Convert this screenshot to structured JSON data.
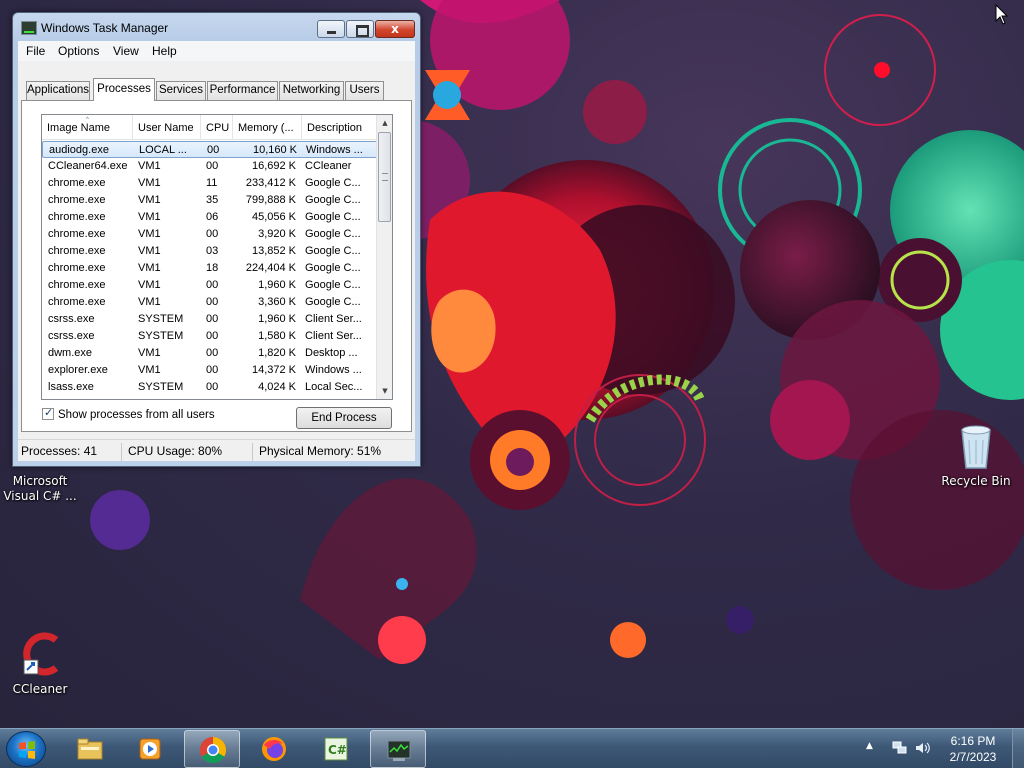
{
  "window": {
    "title": "Windows Task Manager",
    "close_glyph": "x"
  },
  "menu": [
    "File",
    "Options",
    "View",
    "Help"
  ],
  "tabs": [
    "Applications",
    "Processes",
    "Services",
    "Performance",
    "Networking",
    "Users"
  ],
  "active_tab": "Processes",
  "columns": [
    "Image Name",
    "User Name",
    "CPU",
    "Memory (...",
    "Description"
  ],
  "sort_indicator": "^",
  "processes": [
    {
      "name": "audiodg.exe",
      "user": "LOCAL ...",
      "cpu": "00",
      "memory": "10,160 K",
      "description": "Windows ..."
    },
    {
      "name": "CCleaner64.exe",
      "user": "VM1",
      "cpu": "00",
      "memory": "16,692 K",
      "description": "CCleaner"
    },
    {
      "name": "chrome.exe",
      "user": "VM1",
      "cpu": "11",
      "memory": "233,412 K",
      "description": "Google C..."
    },
    {
      "name": "chrome.exe",
      "user": "VM1",
      "cpu": "35",
      "memory": "799,888 K",
      "description": "Google C..."
    },
    {
      "name": "chrome.exe",
      "user": "VM1",
      "cpu": "06",
      "memory": "45,056 K",
      "description": "Google C..."
    },
    {
      "name": "chrome.exe",
      "user": "VM1",
      "cpu": "00",
      "memory": "3,920 K",
      "description": "Google C..."
    },
    {
      "name": "chrome.exe",
      "user": "VM1",
      "cpu": "03",
      "memory": "13,852 K",
      "description": "Google C..."
    },
    {
      "name": "chrome.exe",
      "user": "VM1",
      "cpu": "18",
      "memory": "224,404 K",
      "description": "Google C..."
    },
    {
      "name": "chrome.exe",
      "user": "VM1",
      "cpu": "00",
      "memory": "1,960 K",
      "description": "Google C..."
    },
    {
      "name": "chrome.exe",
      "user": "VM1",
      "cpu": "00",
      "memory": "3,360 K",
      "description": "Google C..."
    },
    {
      "name": "csrss.exe",
      "user": "SYSTEM",
      "cpu": "00",
      "memory": "1,960 K",
      "description": "Client Ser..."
    },
    {
      "name": "csrss.exe",
      "user": "SYSTEM",
      "cpu": "00",
      "memory": "1,580 K",
      "description": "Client Ser..."
    },
    {
      "name": "dwm.exe",
      "user": "VM1",
      "cpu": "00",
      "memory": "1,820 K",
      "description": "Desktop ..."
    },
    {
      "name": "explorer.exe",
      "user": "VM1",
      "cpu": "00",
      "memory": "14,372 K",
      "description": "Windows ..."
    },
    {
      "name": "lsass.exe",
      "user": "SYSTEM",
      "cpu": "00",
      "memory": "4,024 K",
      "description": "Local Sec..."
    }
  ],
  "selected_process_index": 0,
  "show_all_label": "Show processes from all users",
  "show_all_checked": true,
  "end_process_label": "End Process",
  "status": {
    "processes": "Processes: 41",
    "cpu": "CPU Usage: 80%",
    "memory": "Physical Memory: 51%"
  },
  "desktop_icons": {
    "visual_csharp": "Microsoft Visual C# ...",
    "ccleaner": "CCleaner",
    "recycle_bin": "Recycle Bin"
  },
  "taskbar": {
    "pinned": [
      "windows-explorer-icon",
      "media-player-icon",
      "chrome-icon",
      "firefox-icon",
      "visual-csharp-icon",
      "task-manager-icon"
    ],
    "tray_expand": "▲",
    "time": "6:16 PM",
    "date": "2/7/2023"
  },
  "colors": {
    "selection": "#d5e8fb",
    "close_button": "#c2341c",
    "taskbar": "#3d5876"
  }
}
